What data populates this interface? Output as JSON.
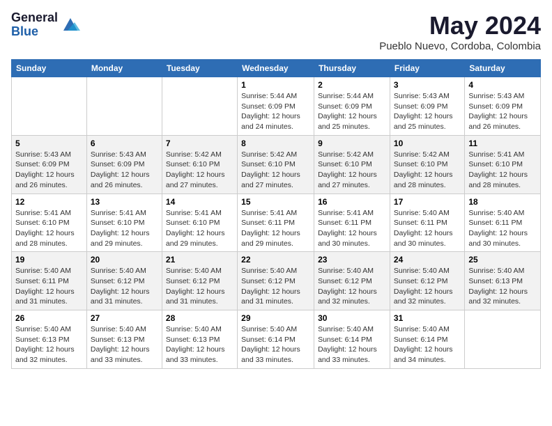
{
  "header": {
    "logo_general": "General",
    "logo_blue": "Blue",
    "month_title": "May 2024",
    "location": "Pueblo Nuevo, Cordoba, Colombia"
  },
  "weekdays": [
    "Sunday",
    "Monday",
    "Tuesday",
    "Wednesday",
    "Thursday",
    "Friday",
    "Saturday"
  ],
  "weeks": [
    [
      {
        "day": "",
        "info": ""
      },
      {
        "day": "",
        "info": ""
      },
      {
        "day": "",
        "info": ""
      },
      {
        "day": "1",
        "info": "Sunrise: 5:44 AM\nSunset: 6:09 PM\nDaylight: 12 hours\nand 24 minutes."
      },
      {
        "day": "2",
        "info": "Sunrise: 5:44 AM\nSunset: 6:09 PM\nDaylight: 12 hours\nand 25 minutes."
      },
      {
        "day": "3",
        "info": "Sunrise: 5:43 AM\nSunset: 6:09 PM\nDaylight: 12 hours\nand 25 minutes."
      },
      {
        "day": "4",
        "info": "Sunrise: 5:43 AM\nSunset: 6:09 PM\nDaylight: 12 hours\nand 26 minutes."
      }
    ],
    [
      {
        "day": "5",
        "info": "Sunrise: 5:43 AM\nSunset: 6:09 PM\nDaylight: 12 hours\nand 26 minutes."
      },
      {
        "day": "6",
        "info": "Sunrise: 5:43 AM\nSunset: 6:09 PM\nDaylight: 12 hours\nand 26 minutes."
      },
      {
        "day": "7",
        "info": "Sunrise: 5:42 AM\nSunset: 6:10 PM\nDaylight: 12 hours\nand 27 minutes."
      },
      {
        "day": "8",
        "info": "Sunrise: 5:42 AM\nSunset: 6:10 PM\nDaylight: 12 hours\nand 27 minutes."
      },
      {
        "day": "9",
        "info": "Sunrise: 5:42 AM\nSunset: 6:10 PM\nDaylight: 12 hours\nand 27 minutes."
      },
      {
        "day": "10",
        "info": "Sunrise: 5:42 AM\nSunset: 6:10 PM\nDaylight: 12 hours\nand 28 minutes."
      },
      {
        "day": "11",
        "info": "Sunrise: 5:41 AM\nSunset: 6:10 PM\nDaylight: 12 hours\nand 28 minutes."
      }
    ],
    [
      {
        "day": "12",
        "info": "Sunrise: 5:41 AM\nSunset: 6:10 PM\nDaylight: 12 hours\nand 28 minutes."
      },
      {
        "day": "13",
        "info": "Sunrise: 5:41 AM\nSunset: 6:10 PM\nDaylight: 12 hours\nand 29 minutes."
      },
      {
        "day": "14",
        "info": "Sunrise: 5:41 AM\nSunset: 6:10 PM\nDaylight: 12 hours\nand 29 minutes."
      },
      {
        "day": "15",
        "info": "Sunrise: 5:41 AM\nSunset: 6:11 PM\nDaylight: 12 hours\nand 29 minutes."
      },
      {
        "day": "16",
        "info": "Sunrise: 5:41 AM\nSunset: 6:11 PM\nDaylight: 12 hours\nand 30 minutes."
      },
      {
        "day": "17",
        "info": "Sunrise: 5:40 AM\nSunset: 6:11 PM\nDaylight: 12 hours\nand 30 minutes."
      },
      {
        "day": "18",
        "info": "Sunrise: 5:40 AM\nSunset: 6:11 PM\nDaylight: 12 hours\nand 30 minutes."
      }
    ],
    [
      {
        "day": "19",
        "info": "Sunrise: 5:40 AM\nSunset: 6:11 PM\nDaylight: 12 hours\nand 31 minutes."
      },
      {
        "day": "20",
        "info": "Sunrise: 5:40 AM\nSunset: 6:12 PM\nDaylight: 12 hours\nand 31 minutes."
      },
      {
        "day": "21",
        "info": "Sunrise: 5:40 AM\nSunset: 6:12 PM\nDaylight: 12 hours\nand 31 minutes."
      },
      {
        "day": "22",
        "info": "Sunrise: 5:40 AM\nSunset: 6:12 PM\nDaylight: 12 hours\nand 31 minutes."
      },
      {
        "day": "23",
        "info": "Sunrise: 5:40 AM\nSunset: 6:12 PM\nDaylight: 12 hours\nand 32 minutes."
      },
      {
        "day": "24",
        "info": "Sunrise: 5:40 AM\nSunset: 6:12 PM\nDaylight: 12 hours\nand 32 minutes."
      },
      {
        "day": "25",
        "info": "Sunrise: 5:40 AM\nSunset: 6:13 PM\nDaylight: 12 hours\nand 32 minutes."
      }
    ],
    [
      {
        "day": "26",
        "info": "Sunrise: 5:40 AM\nSunset: 6:13 PM\nDaylight: 12 hours\nand 32 minutes."
      },
      {
        "day": "27",
        "info": "Sunrise: 5:40 AM\nSunset: 6:13 PM\nDaylight: 12 hours\nand 33 minutes."
      },
      {
        "day": "28",
        "info": "Sunrise: 5:40 AM\nSunset: 6:13 PM\nDaylight: 12 hours\nand 33 minutes."
      },
      {
        "day": "29",
        "info": "Sunrise: 5:40 AM\nSunset: 6:14 PM\nDaylight: 12 hours\nand 33 minutes."
      },
      {
        "day": "30",
        "info": "Sunrise: 5:40 AM\nSunset: 6:14 PM\nDaylight: 12 hours\nand 33 minutes."
      },
      {
        "day": "31",
        "info": "Sunrise: 5:40 AM\nSunset: 6:14 PM\nDaylight: 12 hours\nand 34 minutes."
      },
      {
        "day": "",
        "info": ""
      }
    ]
  ]
}
